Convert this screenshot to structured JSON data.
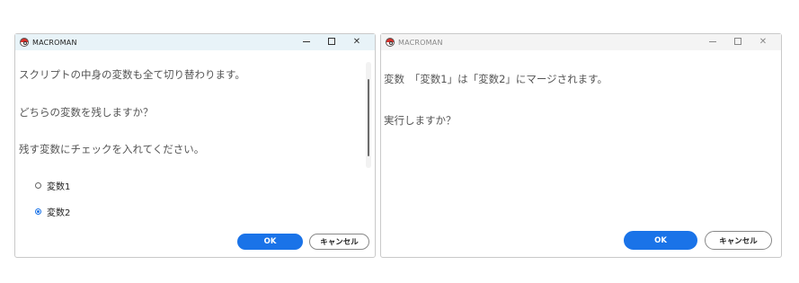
{
  "dialog1": {
    "title": "MACROMAN",
    "line1": "スクリプトの中身の変数も全て切り替わります。",
    "line2": "どちらの変数を残しますか？",
    "line3": "残す変数にチェックを入れてください。",
    "options": [
      {
        "label": "変数1",
        "checked": false
      },
      {
        "label": "変数2",
        "checked": true
      }
    ],
    "ok_label": "OK",
    "cancel_label": "キャンセル"
  },
  "dialog2": {
    "title": "MACROMAN",
    "line1": "変数　「変数1」は「変数2」にマージされます。",
    "line2": "実行しますか？",
    "ok_label": "OK",
    "cancel_label": "キャンセル"
  },
  "window_controls": {
    "minimize": "minimize-icon",
    "maximize": "maximize-icon",
    "close": "close-icon"
  },
  "colors": {
    "accent": "#1a73e8",
    "active_titlebar": "#e8f3f8",
    "inactive_titlebar": "#f4f4f4"
  }
}
